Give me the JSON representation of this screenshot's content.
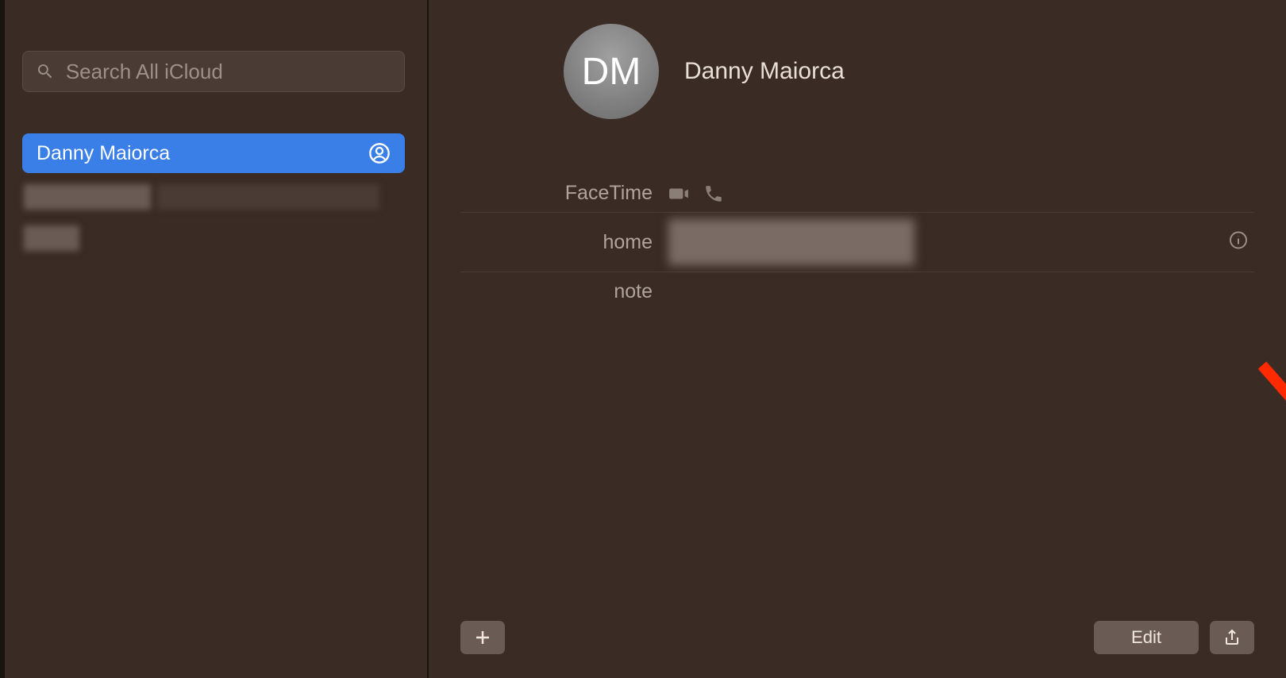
{
  "sidebar": {
    "search_placeholder": "Search All iCloud",
    "contacts": [
      {
        "name": "Danny  Maiorca",
        "selected": true
      }
    ]
  },
  "main": {
    "avatar_initials": "DM",
    "contact_name": "Danny  Maiorca",
    "rows": {
      "facetime_label": "FaceTime",
      "home_label": "home",
      "note_label": "note"
    },
    "buttons": {
      "edit": "Edit"
    }
  }
}
